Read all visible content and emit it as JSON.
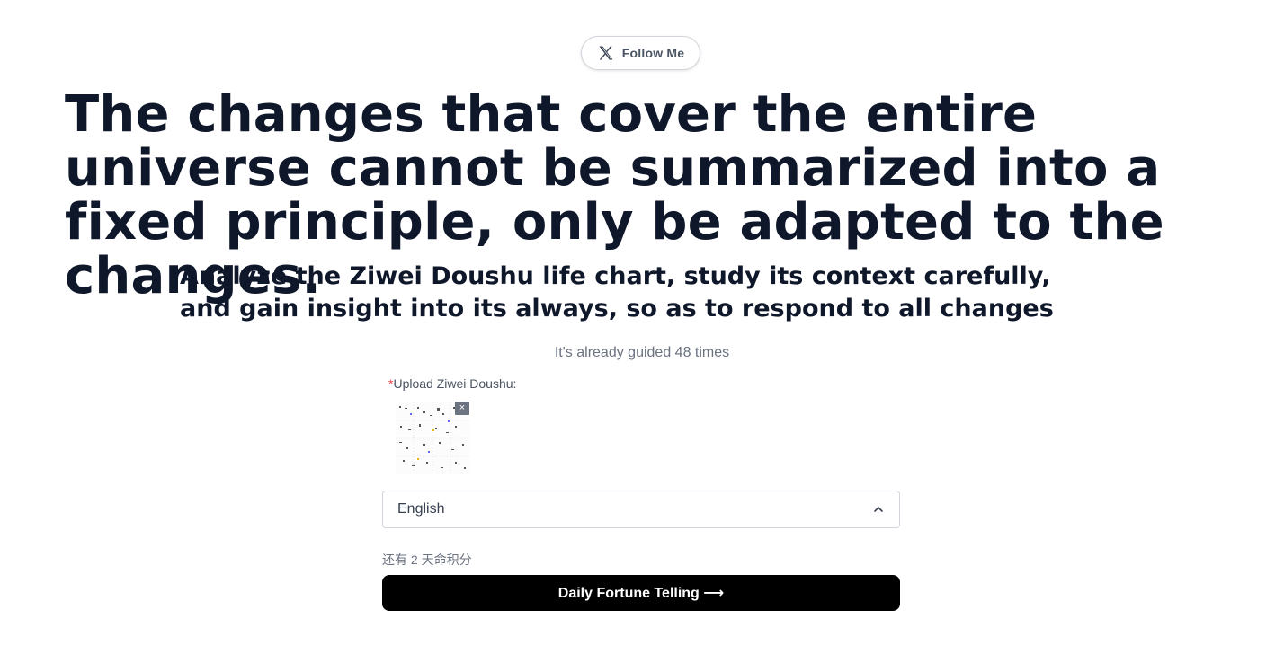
{
  "follow": {
    "label": "Follow Me",
    "icon": "x-logo-icon"
  },
  "hero": {
    "headline": "The changes that cover the entire universe cannot be summarized into a fixed principle, only be adapted to the changes.",
    "subheadline": "Analyze the Ziwei Doushu life chart, study its context carefully, and gain insight into its always, so as to respond to all changes"
  },
  "stats": {
    "guided_text": "It's already guided 48 times"
  },
  "upload": {
    "required_mark": "*",
    "label": "Upload Ziwei Doushu:",
    "remove_symbol": "×",
    "thumbnail_icon": "chart-thumbnail"
  },
  "language_select": {
    "value": "English",
    "icon": "chevron-up-icon"
  },
  "credits": {
    "text": "还有 2 天命积分"
  },
  "cta": {
    "label": "Daily Fortune Telling ⟶"
  },
  "colors": {
    "primary_text": "#0f172a",
    "muted_text": "#6b7280",
    "required": "#ef4444",
    "cta_bg": "#000000"
  }
}
